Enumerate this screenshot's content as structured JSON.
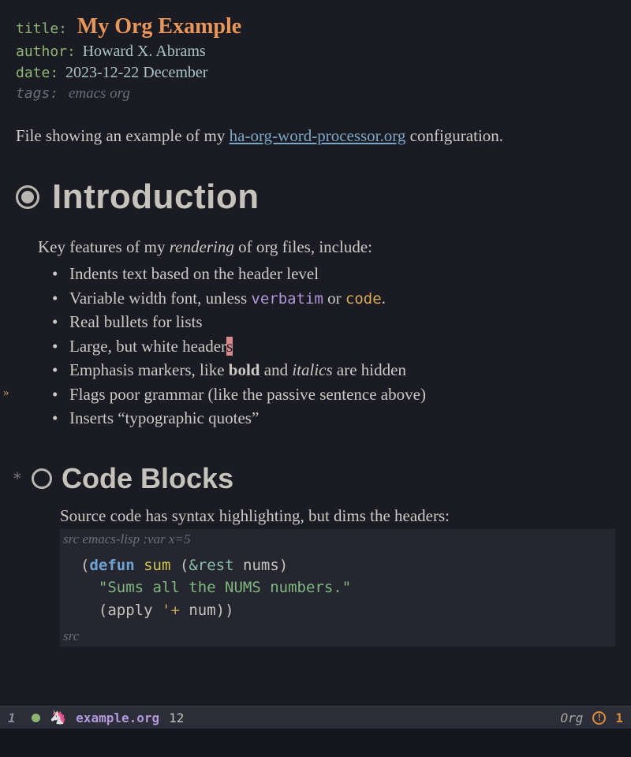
{
  "meta": {
    "title_key": "title:",
    "title_value": "My Org Example",
    "author_key": "author:",
    "author_value": "Howard X. Abrams",
    "date_key": "date:",
    "date_value": "2023-12-22 December",
    "tags_key": "tags:",
    "tags_value": "emacs org"
  },
  "intro": {
    "pre": "File showing an example of my ",
    "link": "ha-org-word-processor.org",
    "post": " configuration."
  },
  "sections": {
    "intro_heading": "Introduction",
    "code_heading": "Code Blocks"
  },
  "features_para_pre": "Key features of my ",
  "features_para_ital": "rendering",
  "features_para_post": " of org files, include:",
  "feature_list": {
    "i0": "Indents text based on the header level",
    "i1_pre": "Variable width font, unless ",
    "i1_verbatim": "verbatim",
    "i1_mid": " or ",
    "i1_code": "code",
    "i1_post": ".",
    "i2": "Real bullets for lists",
    "i3_pre": "Large, but white header",
    "i3_cursor": "s",
    "i4_pre": "Emphasis markers, like ",
    "i4_bold": "bold",
    "i4_mid": " and ",
    "i4_ital": "italics",
    "i4_post": " are hidden",
    "i5": "Flags poor grammar (like the passive sentence above)",
    "i6": "Inserts “typographic quotes”"
  },
  "code_section": {
    "para": "Source code has syntax highlighting, but dims the headers:",
    "header_pre": "src ",
    "header_lang": "emacs-lisp :var x=5",
    "footer": "src",
    "src": {
      "l1_defun": "defun",
      "l1_name": "sum",
      "l1_rest": "&rest",
      "l1_arg": "nums",
      "l2_doc": "\"Sums all the NUMS numbers.\"",
      "l3_apply": "apply",
      "l3_quote": "'+",
      "l3_num": "num"
    }
  },
  "modeline": {
    "line": "1",
    "filename": "example.org",
    "col": "12",
    "mode": "Org",
    "warn_count": "1"
  },
  "fringe": {
    "marker": "»"
  }
}
